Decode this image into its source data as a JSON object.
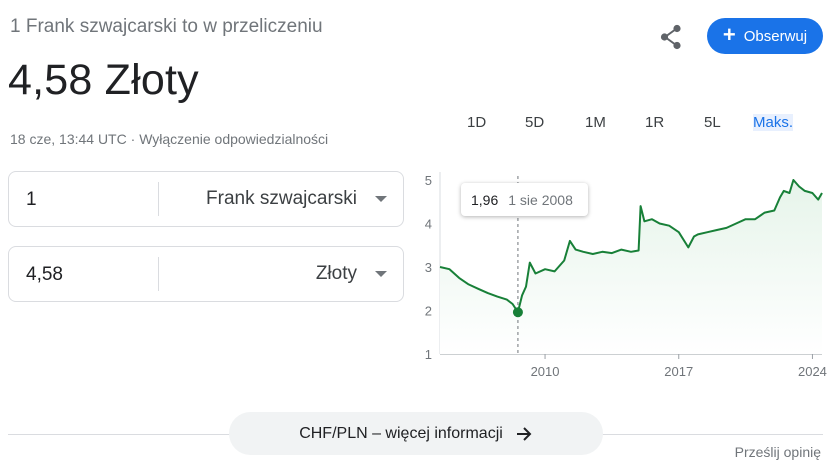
{
  "header": {
    "subtitle": "1 Frank szwajcarski to w przeliczeniu",
    "value": "4,58 Złoty",
    "timestamp": "18 cze, 13:44 UTC",
    "separator": "·",
    "disclaimer": "Wyłączenie odpowiedzialności",
    "follow_label": "Obserwuj",
    "follow_icon": "plus-icon",
    "share_icon": "share-icon"
  },
  "converter": {
    "from_amount": "1",
    "from_currency": "Frank szwajcarski",
    "to_amount": "4,58",
    "to_currency": "Złoty"
  },
  "range_tabs": [
    {
      "label": "1D",
      "active": false
    },
    {
      "label": "5D",
      "active": false
    },
    {
      "label": "1M",
      "active": false
    },
    {
      "label": "1R",
      "active": false
    },
    {
      "label": "5L",
      "active": false
    },
    {
      "label": "Maks.",
      "active": true
    }
  ],
  "tooltip": {
    "value": "1,96",
    "date": "1 sie 2008"
  },
  "chart_data": {
    "type": "area",
    "color": "#188038",
    "fill": "#e6f4ea",
    "ylim": [
      1,
      5
    ],
    "yticks": [
      "1",
      "2",
      "3",
      "4",
      "5"
    ],
    "xlim": [
      2004.5,
      2024.5
    ],
    "xticks": [
      "2010",
      "2017",
      "2024"
    ],
    "xtick_values": [
      2010,
      2017,
      2024
    ],
    "highlight": {
      "x": 2008.58,
      "y": 1.96
    },
    "x": [
      2004.5,
      2005,
      2005.5,
      2006,
      2006.5,
      2007,
      2007.5,
      2008,
      2008.3,
      2008.58,
      2008.8,
      2009,
      2009.2,
      2009.5,
      2010,
      2010.5,
      2011,
      2011.3,
      2011.6,
      2012,
      2012.5,
      2013,
      2013.5,
      2014,
      2014.5,
      2014.9,
      2015.0,
      2015.2,
      2015.6,
      2016,
      2016.5,
      2017,
      2017.5,
      2017.8,
      2018,
      2018.5,
      2019,
      2019.5,
      2020,
      2020.5,
      2021,
      2021.5,
      2022,
      2022.3,
      2022.5,
      2022.8,
      2023,
      2023.3,
      2023.6,
      2024,
      2024.3,
      2024.5
    ],
    "y": [
      3.0,
      2.95,
      2.75,
      2.6,
      2.5,
      2.4,
      2.32,
      2.25,
      2.15,
      1.96,
      2.35,
      2.55,
      3.1,
      2.85,
      2.95,
      2.9,
      3.15,
      3.6,
      3.4,
      3.35,
      3.3,
      3.35,
      3.32,
      3.4,
      3.35,
      3.38,
      4.4,
      4.05,
      4.1,
      4.0,
      3.95,
      3.8,
      3.45,
      3.7,
      3.75,
      3.8,
      3.85,
      3.9,
      4.0,
      4.1,
      4.1,
      4.25,
      4.3,
      4.6,
      4.75,
      4.7,
      5.0,
      4.85,
      4.75,
      4.7,
      4.55,
      4.7
    ]
  },
  "more_info_label": "CHF/PLN – więcej informacji",
  "feedback_label": "Prześlij opinię"
}
